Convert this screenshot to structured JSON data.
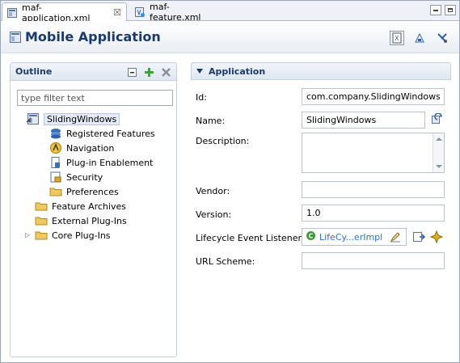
{
  "tabs": [
    {
      "label": "maf-application.xml",
      "close": "☒",
      "icon": "maf-application-file-icon"
    },
    {
      "label": "maf-feature.xml",
      "icon": "maf-feature-file-icon"
    }
  ],
  "header": {
    "title": "Mobile Application",
    "tools": [
      "source-view-icon",
      "adf-icon",
      "preferences-icon"
    ]
  },
  "outline": {
    "title": "Outline",
    "filter_placeholder": "type filter text",
    "tools": [
      "collapse-all-icon",
      "add-icon",
      "delete-icon"
    ],
    "tree": [
      {
        "label": "SlidingWindows",
        "icon": "application-icon",
        "expanded": true,
        "selected": true
      },
      {
        "label": "Registered Features",
        "icon": "features-icon"
      },
      {
        "label": "Navigation",
        "icon": "navigation-icon"
      },
      {
        "label": "Plug-in Enablement",
        "icon": "plugin-icon"
      },
      {
        "label": "Security",
        "icon": "security-icon"
      },
      {
        "label": "Preferences",
        "icon": "folder-icon"
      },
      {
        "label": "Feature Archives",
        "icon": "folder-icon"
      },
      {
        "label": "External Plug-Ins",
        "icon": "folder-icon"
      },
      {
        "label": "Core Plug-Ins",
        "icon": "folder-icon",
        "expanded": false
      }
    ]
  },
  "application": {
    "title": "Application",
    "fields": {
      "id": {
        "label": "Id:",
        "value": "com.company.SlidingWindows"
      },
      "name": {
        "label": "Name:",
        "value": "SlidingWindows"
      },
      "description": {
        "label": "Description:",
        "value": ""
      },
      "vendor": {
        "label": "Vendor:",
        "value": ""
      },
      "version": {
        "label": "Version:",
        "value": "1.0"
      },
      "lifecycle": {
        "label": "Lifecycle Event Listener:",
        "value": "LifeCy...erImpl"
      },
      "url_scheme": {
        "label": "URL Scheme:",
        "value": ""
      }
    }
  },
  "colors": {
    "accent": "#1b3a6b",
    "link": "#2f6fd0",
    "border": "#c5cfdc"
  }
}
